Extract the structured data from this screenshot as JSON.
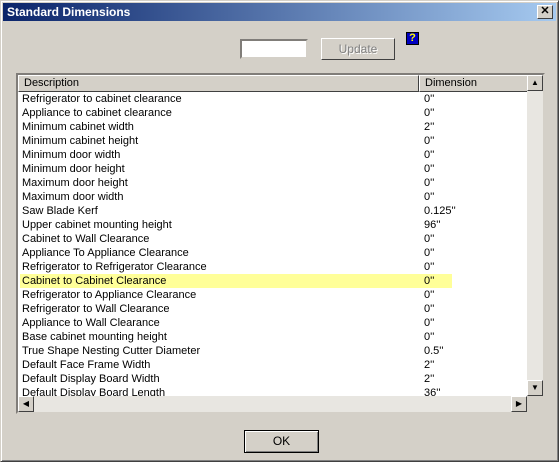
{
  "window": {
    "title": "Standard Dimensions",
    "close_glyph": "✕"
  },
  "toolbar": {
    "input_value": "",
    "update_label": "Update",
    "help_glyph": "?"
  },
  "list": {
    "columns": [
      "Description",
      "Dimension"
    ],
    "rows": [
      {
        "description": "Refrigerator to cabinet clearance",
        "dimension": "0''"
      },
      {
        "description": "Appliance to cabinet clearance",
        "dimension": "0''"
      },
      {
        "description": "Minimum cabinet width",
        "dimension": "2''"
      },
      {
        "description": "Minimum cabinet height",
        "dimension": "0''"
      },
      {
        "description": "Minimum door width",
        "dimension": "0''"
      },
      {
        "description": "Minimum door height",
        "dimension": "0''"
      },
      {
        "description": "Maximum door height",
        "dimension": "0''"
      },
      {
        "description": "Maximum door width",
        "dimension": "0''"
      },
      {
        "description": "Saw Blade Kerf",
        "dimension": "0.125''"
      },
      {
        "description": "Upper cabinet mounting height",
        "dimension": "96''"
      },
      {
        "description": "Cabinet to Wall Clearance",
        "dimension": "0''"
      },
      {
        "description": "Appliance To Appliance Clearance",
        "dimension": "0''"
      },
      {
        "description": "Refrigerator to Refrigerator Clearance",
        "dimension": "0''"
      },
      {
        "description": "Cabinet to Cabinet Clearance",
        "dimension": "0''",
        "selected": true
      },
      {
        "description": "Refrigerator to Appliance Clearance",
        "dimension": "0''"
      },
      {
        "description": "Refrigerator to Wall Clearance",
        "dimension": "0''"
      },
      {
        "description": "Appliance to Wall Clearance",
        "dimension": "0''"
      },
      {
        "description": "Base cabinet mounting height",
        "dimension": "0''"
      },
      {
        "description": "True Shape Nesting Cutter Diameter",
        "dimension": "0.5''"
      },
      {
        "description": "Default Face Frame Width",
        "dimension": "2''"
      },
      {
        "description": "Default Display Board Width",
        "dimension": "2''"
      },
      {
        "description": "Default Display Board Length",
        "dimension": "36''"
      }
    ]
  },
  "footer": {
    "ok_label": "OK"
  },
  "colors": {
    "selection": "#ffff99",
    "title_gradient_start": "#0a246a",
    "title_gradient_end": "#a6caf0"
  }
}
